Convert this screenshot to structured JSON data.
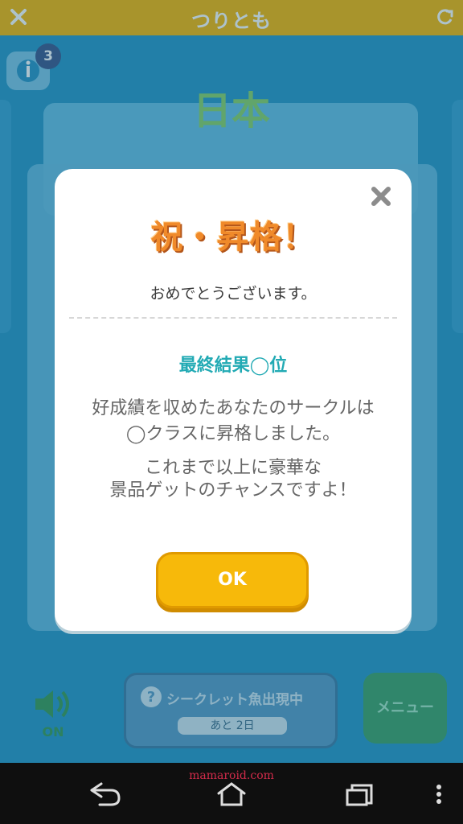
{
  "topbar": {
    "title": "つりとも"
  },
  "info": {
    "badge_count": "3"
  },
  "background": {
    "country": "日本"
  },
  "dialog": {
    "headline": "祝・昇格！",
    "congrats": "おめでとうございます。",
    "result": "最終結果◯位",
    "message1": "好成績を収めたあなたのサークルは\n◯クラスに昇格しました。",
    "message2": "これまで以上に豪華な\n景品ゲットのチャンスですよ！",
    "ok_label": "OK"
  },
  "bottom": {
    "sound_label": "ON",
    "secret_label": "シークレット魚出現中",
    "days_left": "あと 2日",
    "menu_label": "メニュー"
  },
  "watermark": "mamaroid.com",
  "colors": {
    "accent": "#f7b90a",
    "teal": "#22aab4",
    "sky": "#2a98c8"
  }
}
